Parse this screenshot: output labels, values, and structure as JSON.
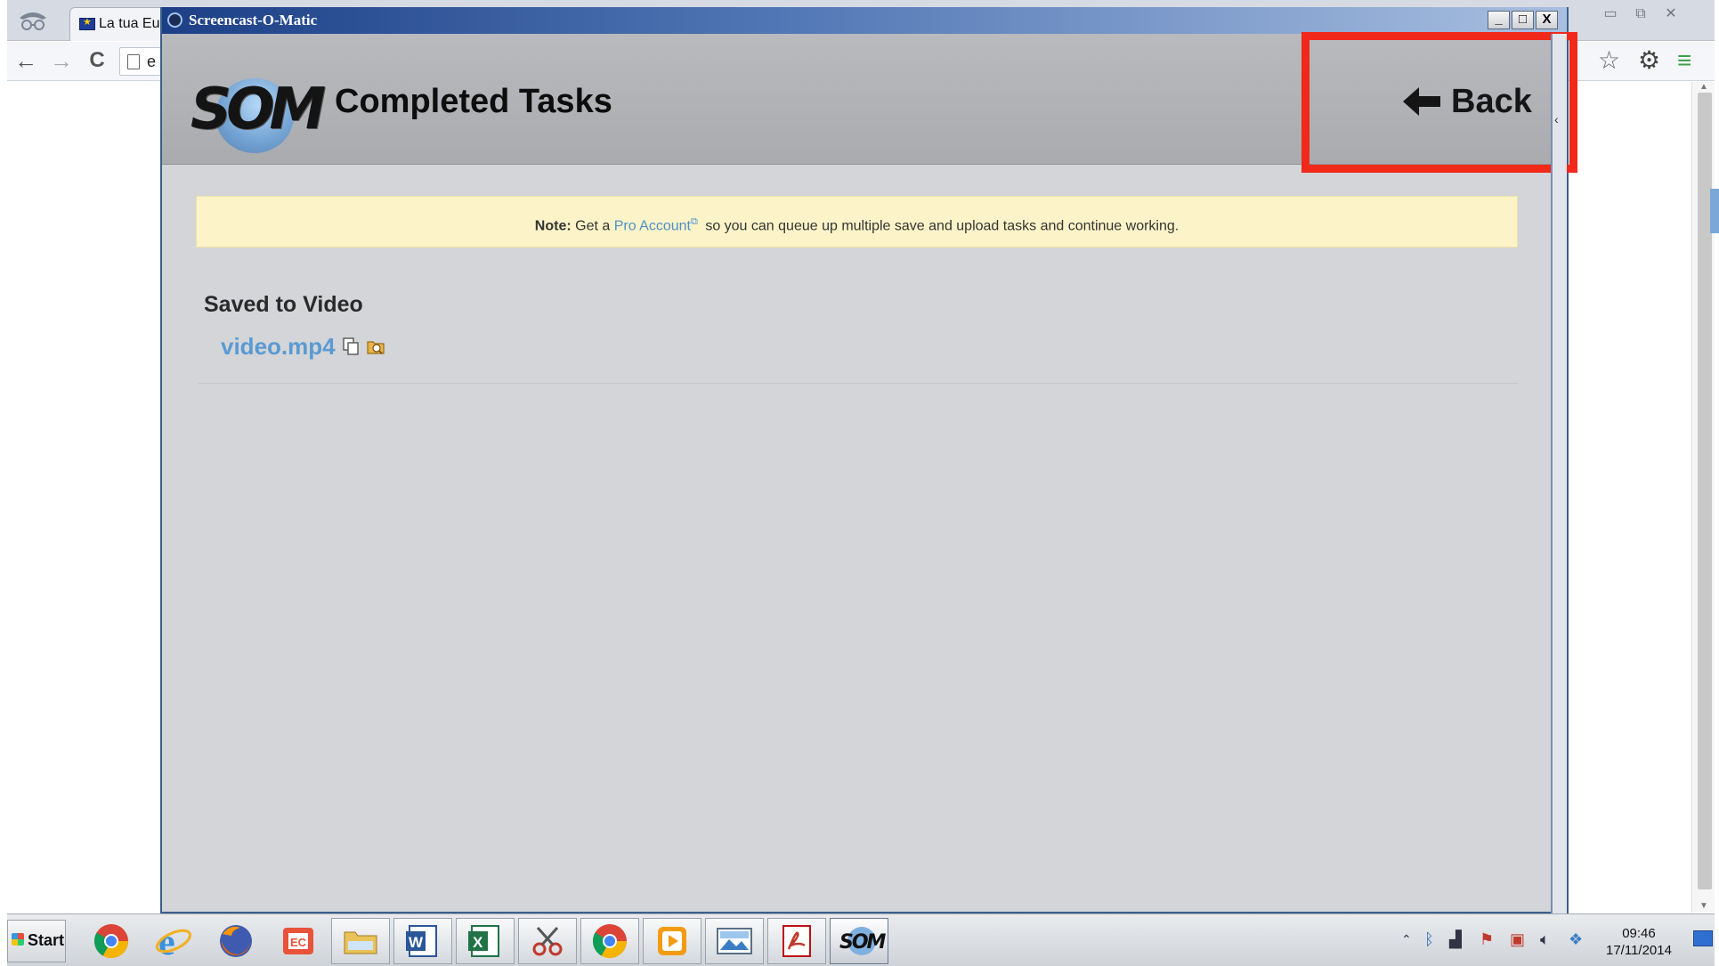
{
  "browser": {
    "tab_title": "La tua Eu",
    "omnibox_text": "e",
    "nav": {
      "back": "←",
      "forward": "→",
      "reload": "C"
    },
    "toolbar_icons": [
      "star-icon",
      "gear-icon",
      "menu-icon"
    ],
    "window_controls": {
      "minimize": "▭",
      "restore": "⧉",
      "close": "✕"
    }
  },
  "som_window": {
    "title": "Screencast-O-Matic",
    "controls": {
      "minimize": "_",
      "maximize": "□",
      "close": "X"
    },
    "logo_text": "SOM",
    "header_title": "Completed Tasks",
    "back_label": "Back",
    "note": {
      "prefix": "Note:",
      "before_link": "Get a",
      "link_text": "Pro Account",
      "after_link": "so you can queue up multiple save and upload tasks and continue working."
    },
    "section_heading": "Saved to Video",
    "file_name": "video.mp4",
    "sidebar_arrow": "‹"
  },
  "taskbar": {
    "start_label": "Start",
    "pinned": [
      "chrome-icon",
      "internet-explorer-icon",
      "firefox-icon",
      "e-reader-icon",
      "file-explorer-icon",
      "word-icon",
      "excel-icon",
      "snipping-tool-icon",
      "chrome-icon",
      "media-player-icon",
      "photo-viewer-icon",
      "pdf-icon",
      "som-icon"
    ],
    "som_label": "SOM",
    "clock_time": "09:46",
    "clock_date": "17/11/2014"
  },
  "colors": {
    "highlight": "#f0291b",
    "link": "#4f90c9",
    "note_bg": "#fcf4c8"
  }
}
